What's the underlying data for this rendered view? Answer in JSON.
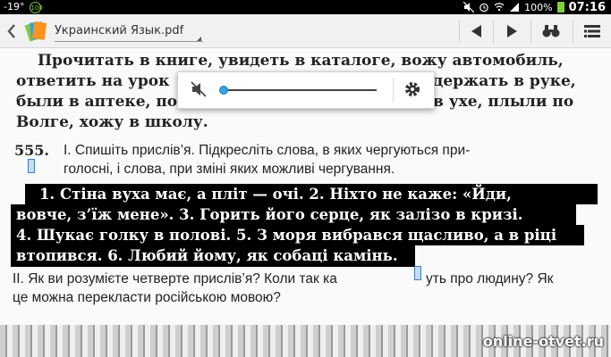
{
  "status_bar": {
    "temperature": "-19°",
    "badge": "100",
    "battery": "100%",
    "time": "07:16"
  },
  "toolbar": {
    "title": "Украинский Язык.pdf",
    "icons": [
      "back-icon",
      "app-icon",
      "prev-page-icon",
      "next-page-icon",
      "binoculars-icon",
      "list-icon"
    ]
  },
  "page": {
    "top_lines": [
      "Прочитать в книге, увидеть в каталоге, вожу автомобиль,",
      "ответить на урок",
      "держать в руке,",
      "были в аптеке, по",
      "в ухе, плыли по",
      "Волге, хожу в школу."
    ],
    "exercise_number": "555.",
    "task1_lines": [
      "І. Спишіть прислів’я. Підкресліть слова, в яких чергуються при-",
      "голосні, і слова, при зміні яких можливі чергування."
    ],
    "highlighted_lines": [
      "1. Стіна вуха має, а пліт — очі. 2. Ніхто не каже: «Йди,",
      "вовче, з’їж мене». 3. Горить його серце, як залізо в кризі.",
      "4. Шукає голку в полові. 5. З моря вибрався щасливо, а в ріці",
      "втопився. 6. Любий йому, як собаці камінь."
    ],
    "task2_lines": [
      "ІІ. Як ви розумієте четверте прислів’я? Коли так ка",
      "уть про людину? Як",
      "це можна перекласти російською мовою?"
    ]
  },
  "volume_popup": {
    "level": 0.0
  },
  "watermark": "online-otvet.ru"
}
